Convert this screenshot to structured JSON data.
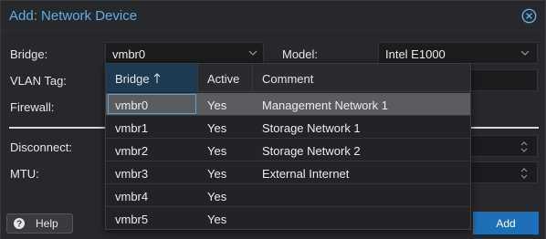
{
  "dialog": {
    "title": "Add: Network Device",
    "close_icon": "close-circle-icon",
    "accent": "#5fb0e8"
  },
  "form": {
    "bridge_label": "Bridge:",
    "bridge_value": "vmbr0",
    "vlan_label": "VLAN Tag:",
    "firewall_label": "Firewall:",
    "model_label": "Model:",
    "model_value": "Intel E1000",
    "disconnect_label": "Disconnect:",
    "mtu_label": "MTU:"
  },
  "footer": {
    "help_label": "Help",
    "add_label": "Add",
    "primary_color": "#1d6fb8"
  },
  "bridge_dropdown": {
    "columns": [
      "Bridge",
      "Active",
      "Comment"
    ],
    "sorted_column": "Bridge",
    "sort_direction": "ascending",
    "rows": [
      {
        "bridge": "vmbr0",
        "active": "Yes",
        "comment": "Management Network 1"
      },
      {
        "bridge": "vmbr1",
        "active": "Yes",
        "comment": "Storage Network 1"
      },
      {
        "bridge": "vmbr2",
        "active": "Yes",
        "comment": "Storage Network 2"
      },
      {
        "bridge": "vmbr3",
        "active": "Yes",
        "comment": "External Internet"
      },
      {
        "bridge": "vmbr4",
        "active": "Yes",
        "comment": ""
      },
      {
        "bridge": "vmbr5",
        "active": "Yes",
        "comment": ""
      }
    ],
    "selected_row": "vmbr0"
  }
}
